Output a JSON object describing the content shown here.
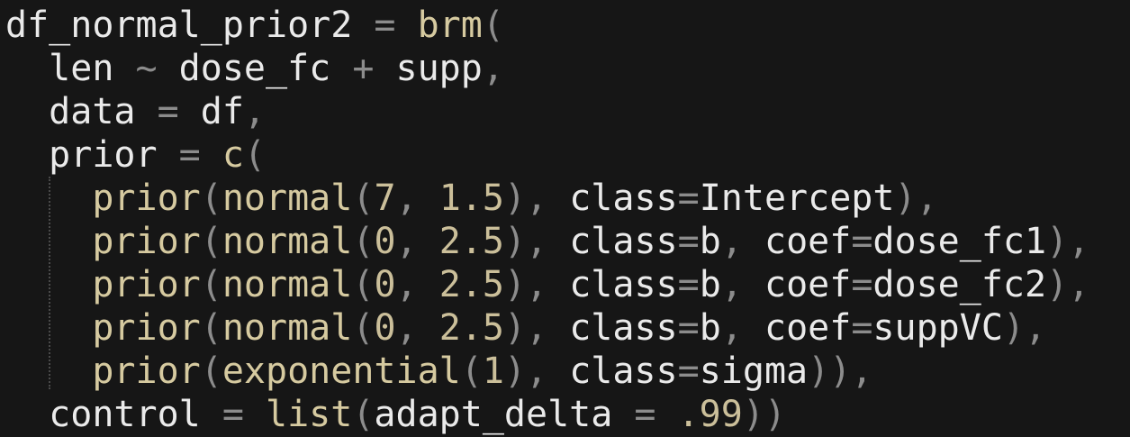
{
  "colors": {
    "background": "#161616",
    "identifier": "#eaeaea",
    "punctuation": "#8c8c8c",
    "function": "#d6caa0",
    "number": "#cbbf9a"
  },
  "code": {
    "lines": [
      [
        {
          "t": "df_normal_prior2",
          "c": "id"
        },
        {
          "t": " = ",
          "c": "punc"
        },
        {
          "t": "brm",
          "c": "fn"
        },
        {
          "t": "(",
          "c": "punc"
        }
      ],
      [
        {
          "t": "  len",
          "c": "id"
        },
        {
          "t": " ~ ",
          "c": "punc"
        },
        {
          "t": "dose_fc",
          "c": "id"
        },
        {
          "t": " + ",
          "c": "punc"
        },
        {
          "t": "supp",
          "c": "id"
        },
        {
          "t": ",",
          "c": "punc"
        }
      ],
      [
        {
          "t": "  data",
          "c": "id"
        },
        {
          "t": " = ",
          "c": "punc"
        },
        {
          "t": "df",
          "c": "id"
        },
        {
          "t": ",",
          "c": "punc"
        }
      ],
      [
        {
          "t": "  prior",
          "c": "id"
        },
        {
          "t": " = ",
          "c": "punc"
        },
        {
          "t": "c",
          "c": "fn"
        },
        {
          "t": "(",
          "c": "punc"
        }
      ],
      [
        {
          "t": "    ",
          "c": "id"
        },
        {
          "t": "prior",
          "c": "fn"
        },
        {
          "t": "(",
          "c": "punc"
        },
        {
          "t": "normal",
          "c": "fn"
        },
        {
          "t": "(",
          "c": "punc"
        },
        {
          "t": "7",
          "c": "num"
        },
        {
          "t": ", ",
          "c": "punc"
        },
        {
          "t": "1.5",
          "c": "num"
        },
        {
          "t": "), ",
          "c": "punc"
        },
        {
          "t": "class",
          "c": "id"
        },
        {
          "t": "=",
          "c": "punc"
        },
        {
          "t": "Intercept",
          "c": "id"
        },
        {
          "t": "),",
          "c": "punc"
        }
      ],
      [
        {
          "t": "    ",
          "c": "id"
        },
        {
          "t": "prior",
          "c": "fn"
        },
        {
          "t": "(",
          "c": "punc"
        },
        {
          "t": "normal",
          "c": "fn"
        },
        {
          "t": "(",
          "c": "punc"
        },
        {
          "t": "0",
          "c": "num"
        },
        {
          "t": ", ",
          "c": "punc"
        },
        {
          "t": "2.5",
          "c": "num"
        },
        {
          "t": "), ",
          "c": "punc"
        },
        {
          "t": "class",
          "c": "id"
        },
        {
          "t": "=",
          "c": "punc"
        },
        {
          "t": "b",
          "c": "id"
        },
        {
          "t": ", ",
          "c": "punc"
        },
        {
          "t": "coef",
          "c": "id"
        },
        {
          "t": "=",
          "c": "punc"
        },
        {
          "t": "dose_fc1",
          "c": "id"
        },
        {
          "t": "),",
          "c": "punc"
        }
      ],
      [
        {
          "t": "    ",
          "c": "id"
        },
        {
          "t": "prior",
          "c": "fn"
        },
        {
          "t": "(",
          "c": "punc"
        },
        {
          "t": "normal",
          "c": "fn"
        },
        {
          "t": "(",
          "c": "punc"
        },
        {
          "t": "0",
          "c": "num"
        },
        {
          "t": ", ",
          "c": "punc"
        },
        {
          "t": "2.5",
          "c": "num"
        },
        {
          "t": "), ",
          "c": "punc"
        },
        {
          "t": "class",
          "c": "id"
        },
        {
          "t": "=",
          "c": "punc"
        },
        {
          "t": "b",
          "c": "id"
        },
        {
          "t": ", ",
          "c": "punc"
        },
        {
          "t": "coef",
          "c": "id"
        },
        {
          "t": "=",
          "c": "punc"
        },
        {
          "t": "dose_fc2",
          "c": "id"
        },
        {
          "t": "),",
          "c": "punc"
        }
      ],
      [
        {
          "t": "    ",
          "c": "id"
        },
        {
          "t": "prior",
          "c": "fn"
        },
        {
          "t": "(",
          "c": "punc"
        },
        {
          "t": "normal",
          "c": "fn"
        },
        {
          "t": "(",
          "c": "punc"
        },
        {
          "t": "0",
          "c": "num"
        },
        {
          "t": ", ",
          "c": "punc"
        },
        {
          "t": "2.5",
          "c": "num"
        },
        {
          "t": "), ",
          "c": "punc"
        },
        {
          "t": "class",
          "c": "id"
        },
        {
          "t": "=",
          "c": "punc"
        },
        {
          "t": "b",
          "c": "id"
        },
        {
          "t": ", ",
          "c": "punc"
        },
        {
          "t": "coef",
          "c": "id"
        },
        {
          "t": "=",
          "c": "punc"
        },
        {
          "t": "suppVC",
          "c": "id"
        },
        {
          "t": "),",
          "c": "punc"
        }
      ],
      [
        {
          "t": "    ",
          "c": "id"
        },
        {
          "t": "prior",
          "c": "fn"
        },
        {
          "t": "(",
          "c": "punc"
        },
        {
          "t": "exponential",
          "c": "fn"
        },
        {
          "t": "(",
          "c": "punc"
        },
        {
          "t": "1",
          "c": "num"
        },
        {
          "t": "), ",
          "c": "punc"
        },
        {
          "t": "class",
          "c": "id"
        },
        {
          "t": "=",
          "c": "punc"
        },
        {
          "t": "sigma",
          "c": "id"
        },
        {
          "t": ")),",
          "c": "punc"
        }
      ],
      [
        {
          "t": "  control",
          "c": "id"
        },
        {
          "t": " = ",
          "c": "punc"
        },
        {
          "t": "list",
          "c": "fn"
        },
        {
          "t": "(",
          "c": "punc"
        },
        {
          "t": "adapt_delta",
          "c": "id"
        },
        {
          "t": " = ",
          "c": "punc"
        },
        {
          "t": ".99",
          "c": "num"
        },
        {
          "t": "))",
          "c": "punc"
        }
      ]
    ]
  }
}
